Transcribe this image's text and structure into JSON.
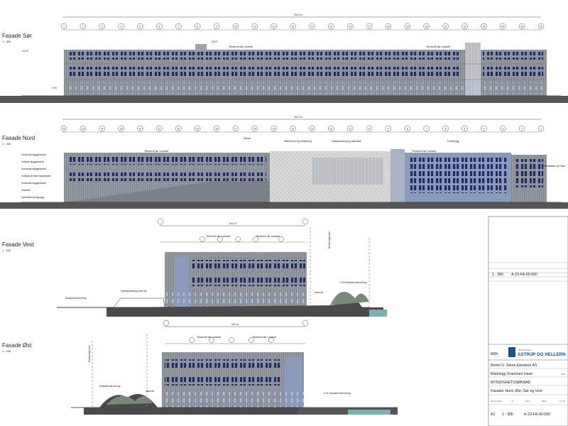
{
  "facades": {
    "sor": {
      "title": "Fasade Sør",
      "scale": "1 : 300",
      "dimension": "300.0 m",
      "grid_labels": [
        "1",
        "2",
        "3",
        "4",
        "5",
        "6",
        "7",
        "8",
        "9",
        "10",
        "11",
        "12",
        "13",
        "14",
        "15",
        "16",
        "17",
        "18",
        "19",
        "20",
        "21",
        "22",
        "23",
        "24",
        "25",
        "26"
      ],
      "roof_note": "Tilkomst til tak i vanskeli",
      "roof_note_2": "Tilkomst til tak i vanskeli",
      "heights": {
        "top": "+25.27",
        "parapet": "+22.00",
        "ground": "+2.90"
      }
    },
    "nord": {
      "title": "Fasade Nord",
      "scale": "1 : 300",
      "dimension": "300.0 m",
      "grid_labels": [
        "26",
        "25",
        "24",
        "23",
        "22",
        "21",
        "20",
        "19",
        "18",
        "17",
        "16",
        "15",
        "14",
        "13",
        "12",
        "11",
        "10",
        "9",
        "8",
        "7",
        "6",
        "5",
        "4",
        "3",
        "2",
        "1"
      ],
      "roof_note": "Tilkomst til tak i vanskeli",
      "roof_note_2": "Tilkomst til tak i vanskeli",
      "annotations": [
        "Rampe",
        "Mötetorsoon og oveikrering",
        "Sykkelparkering og skjermtak",
        "Kontorbygg",
        "Fasadeklæs og Proun"
      ],
      "left_labels": [
        "Horisontal skyggeavslutt",
        "Vertikalt skyggeavslutt",
        "Horisontal skyggeavslutt",
        "Vertikalt perforert fasadeplate",
        "Horisontal skyggeavslutt",
        "Glassfelt",
        "Kjørebelte betongvegg"
      ]
    },
    "vest": {
      "title": "Fasade Vest",
      "scale": "1 : 300",
      "dimension": "60.0 m",
      "roof_note": "Tilkomst til tak i vanskeli",
      "roof_note_2": "Tilkomst til tak i vanskeli",
      "annotations": [
        "Sykkelparkering under tak",
        "Eksisterende terreng",
        "Internvei",
        "+1.90 Eksisterende terreng",
        "Eiendomsgrense"
      ]
    },
    "ost": {
      "title": "Fasade Øst",
      "scale": "1 : 300",
      "dimension": "60.0 m",
      "roof_note": "Tilkomst til tak i vanskeli",
      "roof_note_2": "Tilkomst til tak i vanskeli",
      "annotations": [
        "Eksisterende terreng",
        "Internvei",
        "+1.90 Eksisterende terreng",
        "Eiendomsgrense"
      ]
    }
  },
  "title_block": {
    "scale_top": "1 : 300",
    "drawing_no_top": "A-23-FA-00-000",
    "firm": "ASTRUP OG HELLERN",
    "firm_prefix": "ARKITEKTER",
    "discipline": "ARK",
    "client": "Bertel O. Steen Eiendom AS",
    "project": "Bilanlegg Drammen Havn",
    "project_no": "4307",
    "phase": "MYNDIGHETSSØKNAD",
    "content": "Fasader Nord, Øst, Sør og Vest",
    "date": "05.01.2022",
    "drawn": "JY",
    "checked": "HHA",
    "approved": "MBA",
    "format": "A1",
    "scale": "1 : 300",
    "drawing_no": "A-23-FA-00-000",
    "revision": "27.06"
  },
  "colors": {
    "cladding": "#8e9299",
    "cladding_light": "#b7bbc1",
    "window": "#1f2e66",
    "window_light": "#9fb6d6",
    "ground": "#4a4a4a",
    "water": "#7fb0b0",
    "foliage": "#7a8a7a",
    "line": "#222222"
  }
}
